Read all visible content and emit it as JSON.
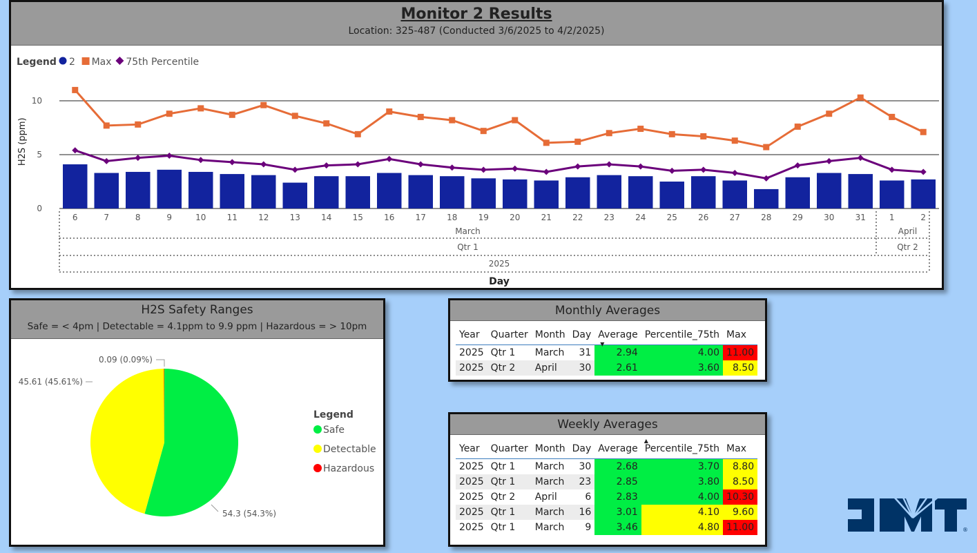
{
  "main": {
    "title": "Monitor 2 Results",
    "subtitle": "Location: 325-487 (Conducted 3/6/2025 to 4/2/2025)"
  },
  "chart_data": [
    {
      "type": "bar+line",
      "legend_title": "Legend",
      "legend_placement": "top-left",
      "ylabel": "H2S (ppm)",
      "xlabel": "Day",
      "ylim": [
        0,
        12
      ],
      "yticks": [
        0,
        5,
        10
      ],
      "gridlines_at": [
        5,
        10
      ],
      "categories": [
        "6",
        "7",
        "8",
        "9",
        "10",
        "11",
        "12",
        "13",
        "14",
        "15",
        "16",
        "17",
        "18",
        "19",
        "20",
        "21",
        "22",
        "23",
        "24",
        "25",
        "26",
        "27",
        "28",
        "29",
        "30",
        "31",
        "1",
        "2"
      ],
      "month_groups": [
        {
          "label": "March",
          "span": 26
        },
        {
          "label": "April",
          "span": 2
        }
      ],
      "quarter_groups": [
        {
          "label": "Qtr 1",
          "span": 26
        },
        {
          "label": "Qtr 2",
          "span": 2
        }
      ],
      "year_groups": [
        {
          "label": "2025",
          "span": 28
        }
      ],
      "series": [
        {
          "name": "2",
          "kind": "bar",
          "color": "#12239e",
          "values": [
            4.1,
            3.3,
            3.4,
            3.6,
            3.4,
            3.2,
            3.1,
            2.4,
            3.0,
            3.0,
            3.3,
            3.1,
            3.0,
            2.8,
            2.7,
            2.6,
            2.9,
            3.1,
            3.0,
            2.5,
            3.0,
            2.6,
            1.8,
            2.9,
            3.3,
            3.2,
            2.6,
            2.7
          ]
        },
        {
          "name": "Max",
          "kind": "line",
          "marker": "square",
          "color": "#e66c37",
          "values": [
            11.0,
            7.7,
            7.8,
            8.8,
            9.3,
            8.7,
            9.6,
            8.6,
            7.9,
            6.9,
            9.0,
            8.5,
            8.2,
            7.2,
            8.2,
            6.1,
            6.2,
            7.0,
            7.4,
            6.9,
            6.7,
            6.3,
            5.7,
            7.6,
            8.8,
            10.3,
            8.5,
            7.1
          ]
        },
        {
          "name": "75th Percentile",
          "kind": "line",
          "marker": "diamond",
          "color": "#6b007b",
          "values": [
            5.4,
            4.4,
            4.7,
            4.9,
            4.5,
            4.3,
            4.1,
            3.6,
            4.0,
            4.1,
            4.6,
            4.1,
            3.8,
            3.6,
            3.7,
            3.4,
            3.9,
            4.1,
            3.9,
            3.5,
            3.6,
            3.3,
            2.8,
            4.0,
            4.4,
            4.7,
            3.6,
            3.4
          ]
        }
      ]
    },
    {
      "type": "pie",
      "title": "H2S Safety Ranges",
      "subtitle": "Safe = < 4pm | Detectable = 4.1ppm to 9.9 ppm | Hazardous = > 10pm",
      "legend_title": "Legend",
      "legend_placement": "right",
      "slices": [
        {
          "name": "Safe",
          "value": 54.3,
          "label": "54.3 (54.3%)",
          "color": "#00ee44"
        },
        {
          "name": "Detectable",
          "value": 45.61,
          "label": "45.61 (45.61%)",
          "color": "#ffff00"
        },
        {
          "name": "Hazardous",
          "value": 0.09,
          "label": "0.09 (0.09%)",
          "color": "#ff0000"
        }
      ]
    }
  ],
  "monthly": {
    "title": "Monthly Averages",
    "columns": [
      "Year",
      "Quarter",
      "Month",
      "Day",
      "Average",
      "Percentile_75th",
      "Max"
    ],
    "sort_column": "Average",
    "rows": [
      {
        "year": "2025",
        "quarter": "Qtr 1",
        "month": "March",
        "day": "31",
        "avg": "2.94",
        "avg_c": "g",
        "p75": "4.00",
        "p75_c": "g",
        "max": "11.00",
        "max_c": "r"
      },
      {
        "year": "2025",
        "quarter": "Qtr 2",
        "month": "April",
        "day": "30",
        "avg": "2.61",
        "avg_c": "g",
        "p75": "3.60",
        "p75_c": "g",
        "max": "8.50",
        "max_c": "y"
      }
    ]
  },
  "weekly": {
    "title": "Weekly Averages",
    "columns": [
      "Year",
      "Quarter",
      "Month",
      "Day",
      "Average",
      "Percentile_75th",
      "Max"
    ],
    "sort_column": "Percentile_75th",
    "rows": [
      {
        "year": "2025",
        "quarter": "Qtr 1",
        "month": "March",
        "day": "30",
        "avg": "2.68",
        "avg_c": "g",
        "p75": "3.70",
        "p75_c": "g",
        "max": "8.80",
        "max_c": "y"
      },
      {
        "year": "2025",
        "quarter": "Qtr 1",
        "month": "March",
        "day": "23",
        "avg": "2.85",
        "avg_c": "g",
        "p75": "3.80",
        "p75_c": "g",
        "max": "8.50",
        "max_c": "y"
      },
      {
        "year": "2025",
        "quarter": "Qtr 2",
        "month": "April",
        "day": "6",
        "avg": "2.83",
        "avg_c": "g",
        "p75": "4.00",
        "p75_c": "g",
        "max": "10.30",
        "max_c": "r"
      },
      {
        "year": "2025",
        "quarter": "Qtr 1",
        "month": "March",
        "day": "16",
        "avg": "3.01",
        "avg_c": "g",
        "p75": "4.10",
        "p75_c": "y",
        "max": "9.60",
        "max_c": "y"
      },
      {
        "year": "2025",
        "quarter": "Qtr 1",
        "month": "March",
        "day": "9",
        "avg": "3.46",
        "avg_c": "g",
        "p75": "4.80",
        "p75_c": "y",
        "max": "11.00",
        "max_c": "r"
      }
    ]
  },
  "logo": {
    "text": "JMT",
    "color": "#003366"
  }
}
